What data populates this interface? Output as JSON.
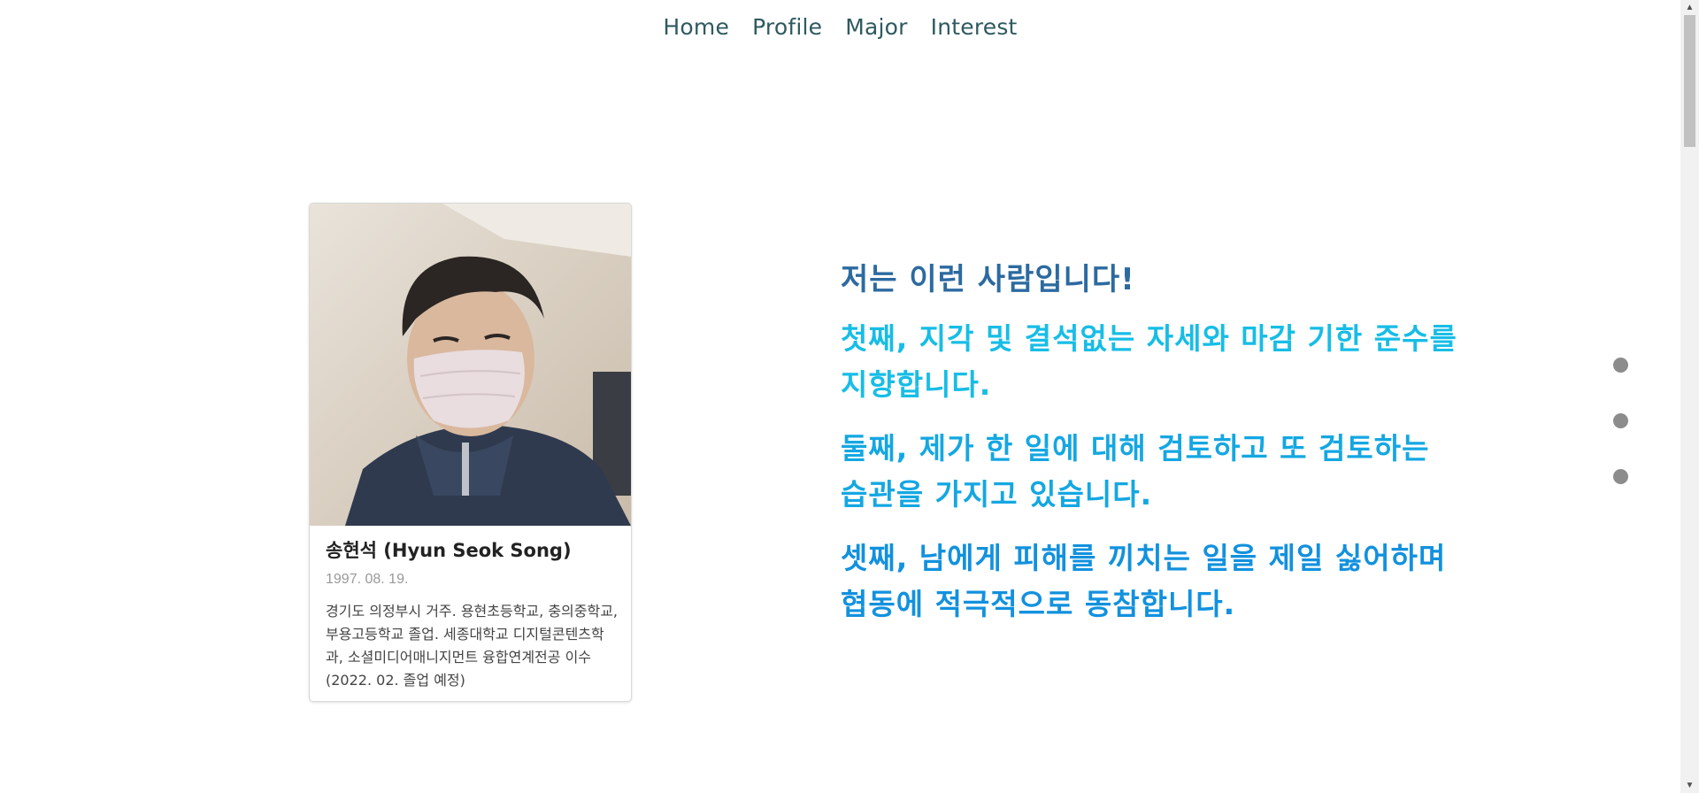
{
  "nav": {
    "items": [
      "Home",
      "Profile",
      "Major",
      "Interest"
    ]
  },
  "profile": {
    "name": "송현석 (Hyun Seok Song)",
    "birth": "1997. 08. 19.",
    "description": "경기도 의정부시 거주. 용현초등학교, 충의중학교, 부용고등학교 졸업. 세종대학교 디지털콘텐츠학과, 소셜미디어매니지먼트 융합연계전공 이수 (2022. 02. 졸업 예정)"
  },
  "intro": {
    "heading": "저는 이런 사람입니다!",
    "points": [
      "첫째, 지각 및 결석없는 자세와 마감 기한 준수를 지향합니다.",
      "둘째, 제가 한 일에 대해 검토하고 또 검토하는 습관을 가지고 있습니다.",
      "셋째, 남에게 피해를 끼치는 일을 제일 싫어하며 협동에 적극적으로 동참합니다."
    ]
  },
  "colors": {
    "nav": "#2f5a5f",
    "heading": "#2c6aa0",
    "point1": "#17bde6",
    "point2": "#14a7e2",
    "point3": "#1291de",
    "dot": "#8c8c8c"
  },
  "section_dots": 3
}
